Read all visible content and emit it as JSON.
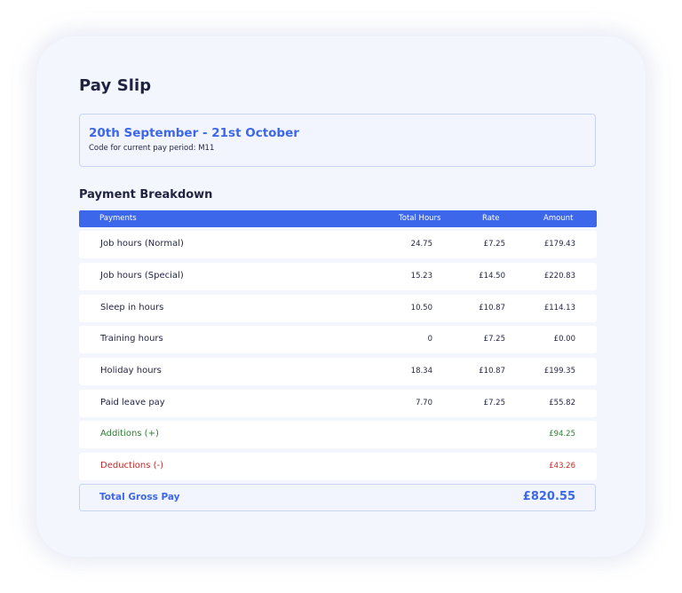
{
  "title": "Pay Slip",
  "period": {
    "range": "20th September - 21st October",
    "code_text": "Code for current pay period: M11"
  },
  "breakdown": {
    "title": "Payment Breakdown",
    "headers": {
      "payments": "Payments",
      "hours": "Total Hours",
      "rate": "Rate",
      "amount": "Amount"
    },
    "rows": [
      {
        "label": "Job hours (Normal)",
        "hours": "24.75",
        "rate": "£7.25",
        "amount": "£179.43"
      },
      {
        "label": "Job hours (Special)",
        "hours": "15.23",
        "rate": "£14.50",
        "amount": "£220.83"
      },
      {
        "label": "Sleep in hours",
        "hours": "10.50",
        "rate": "£10.87",
        "amount": "£114.13"
      },
      {
        "label": "Training hours",
        "hours": "0",
        "rate": "£7.25",
        "amount": "£0.00"
      },
      {
        "label": "Holiday hours",
        "hours": "18.34",
        "rate": "£10.87",
        "amount": "£199.35"
      },
      {
        "label": "Paid leave pay",
        "hours": "7.70",
        "rate": "£7.25",
        "amount": "£55.82"
      }
    ],
    "additions": {
      "label": "Additions (+)",
      "amount": "£94.25"
    },
    "deductions": {
      "label": "Deductions (-)",
      "amount": "£43.26"
    },
    "total": {
      "label": "Total Gross Pay",
      "amount": "£820.55"
    }
  },
  "colors": {
    "accent": "#3d67ea",
    "positive": "#2e7d32",
    "negative": "#c62828",
    "text": "#1f2340"
  }
}
